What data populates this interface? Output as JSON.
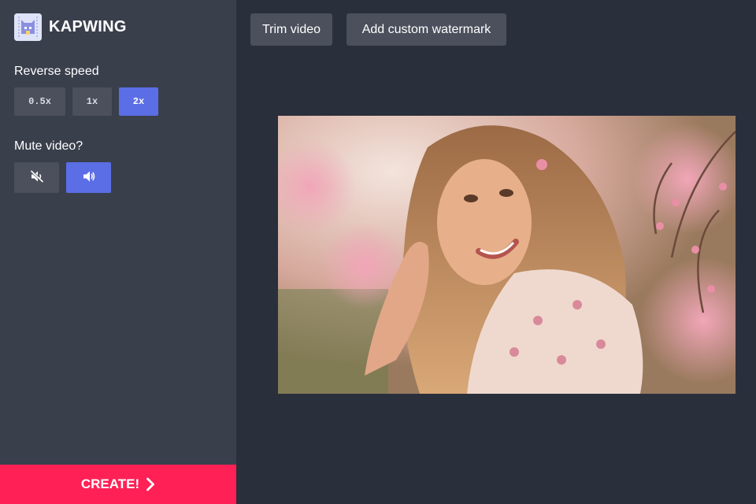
{
  "app": {
    "brand": "KAPWING"
  },
  "sidebar": {
    "reverse_speed_label": "Reverse speed",
    "speeds": [
      {
        "label": "0.5x",
        "selected": false
      },
      {
        "label": "1x",
        "selected": false
      },
      {
        "label": "2x",
        "selected": true
      }
    ],
    "mute_label": "Mute video?",
    "mute_options": [
      {
        "icon": "speaker-muted-icon",
        "selected": false
      },
      {
        "icon": "speaker-on-icon",
        "selected": true
      }
    ],
    "create_label": "CREATE!"
  },
  "toolbar": {
    "trim_label": "Trim video",
    "watermark_label": "Add custom watermark"
  },
  "colors": {
    "sidebar_bg": "#3a3f4c",
    "main_bg": "#2a2f3c",
    "accent": "#5b6ee6",
    "create": "#ff2156",
    "button_bg": "#4b505c"
  }
}
